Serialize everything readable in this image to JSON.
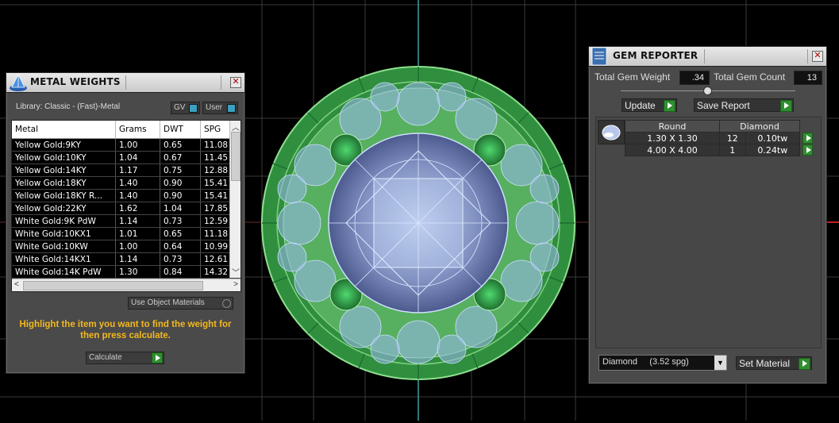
{
  "metal_weights": {
    "title": "METAL WEIGHTS",
    "library": "Library: Classic - (Fast)-Metal",
    "toggle_gv": "GV",
    "toggle_user": "User",
    "columns": [
      "Metal",
      "Grams",
      "DWT",
      "SPG"
    ],
    "rows": [
      [
        "Yellow Gold:9KY",
        "1.00",
        "0.65",
        "11.08"
      ],
      [
        "Yellow Gold:10KY",
        "1.04",
        "0.67",
        "11.45"
      ],
      [
        "Yellow Gold:14KY",
        "1.17",
        "0.75",
        "12.88"
      ],
      [
        "Yellow Gold:18KY",
        "1.40",
        "0.90",
        "15.41"
      ],
      [
        "Yellow Gold:18KY R...",
        "1.40",
        "0.90",
        "15.41"
      ],
      [
        "Yellow Gold:22KY",
        "1.62",
        "1.04",
        "17.85"
      ],
      [
        "White Gold:9K PdW",
        "1.14",
        "0.73",
        "12.59"
      ],
      [
        "White Gold:10KX1",
        "1.01",
        "0.65",
        "11.18"
      ],
      [
        "White Gold:10KW",
        "1.00",
        "0.64",
        "10.99"
      ],
      [
        "White Gold:14KX1",
        "1.14",
        "0.73",
        "12.61"
      ],
      [
        "White Gold:14K PdW",
        "1.30",
        "0.84",
        "14.32"
      ]
    ],
    "use_object_materials": "Use Object Materials",
    "hint": "Highlight the item you want to find the weight for then press calculate.",
    "calculate": "Calculate"
  },
  "gem_reporter": {
    "title": "GEM REPORTER",
    "total_weight_label": "Total Gem Weight",
    "total_weight_value": ".34",
    "total_count_label": "Total Gem Count",
    "total_count_value": "13",
    "update": "Update",
    "save_report": "Save Report",
    "table_headers": [
      "Round",
      "Diamond"
    ],
    "rows": [
      {
        "size": "1.30 X 1.30",
        "count": "12",
        "weight": "0.10tw"
      },
      {
        "size": "4.00 X 4.00",
        "count": "1",
        "weight": "0.24tw"
      }
    ],
    "material": "Diamond     (3.52 spg)",
    "set_material": "Set Material"
  },
  "colors": {
    "accent_green": "#2f8f2f",
    "hint_yellow": "#f2b81c",
    "gem_wire": "#7fb0ff",
    "metal_green": "#3fbf4f"
  }
}
